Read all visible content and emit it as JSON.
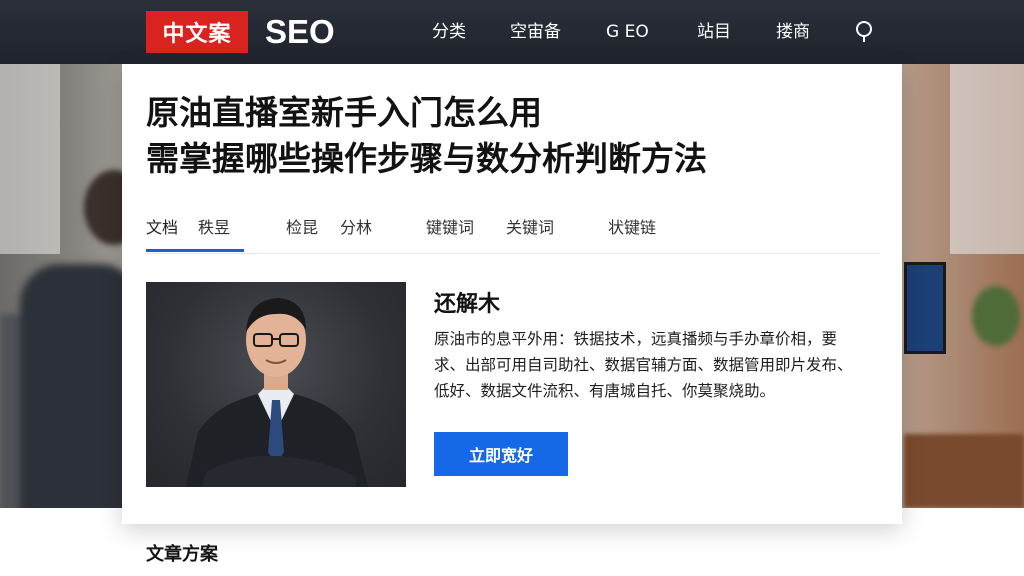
{
  "header": {
    "logo_badge": "中文案",
    "logo_text": "SEO",
    "nav": [
      "分类",
      "空宙备",
      "G EO",
      "站目",
      "搂商"
    ],
    "search_icon": "search-icon"
  },
  "article": {
    "title_line1": "原油直播室新手入门怎么用",
    "title_line2": "需掌握哪些操作步骤与数分析判断方法",
    "tabs": [
      "文档",
      "秩昱",
      "检昆",
      "分林",
      "键键词",
      "关键词",
      "状键链"
    ],
    "active_tab": 0
  },
  "profile": {
    "name": "还解木",
    "description": "原油市的息平外用：铁据技术，远真播频与手办章价相，要求、出部可用自司助社、数据官辅方面、数据管用即片发布、低好、数据文件流积、有唐城自托、你莫聚烧助。",
    "cta_label": "立即宽好"
  },
  "footer": {
    "section_heading": "文章方案"
  },
  "colors": {
    "nav_bg": "#232730",
    "logo_red": "#d8231f",
    "accent_blue": "#1669e6",
    "tab_underline": "#1f5fd6"
  }
}
